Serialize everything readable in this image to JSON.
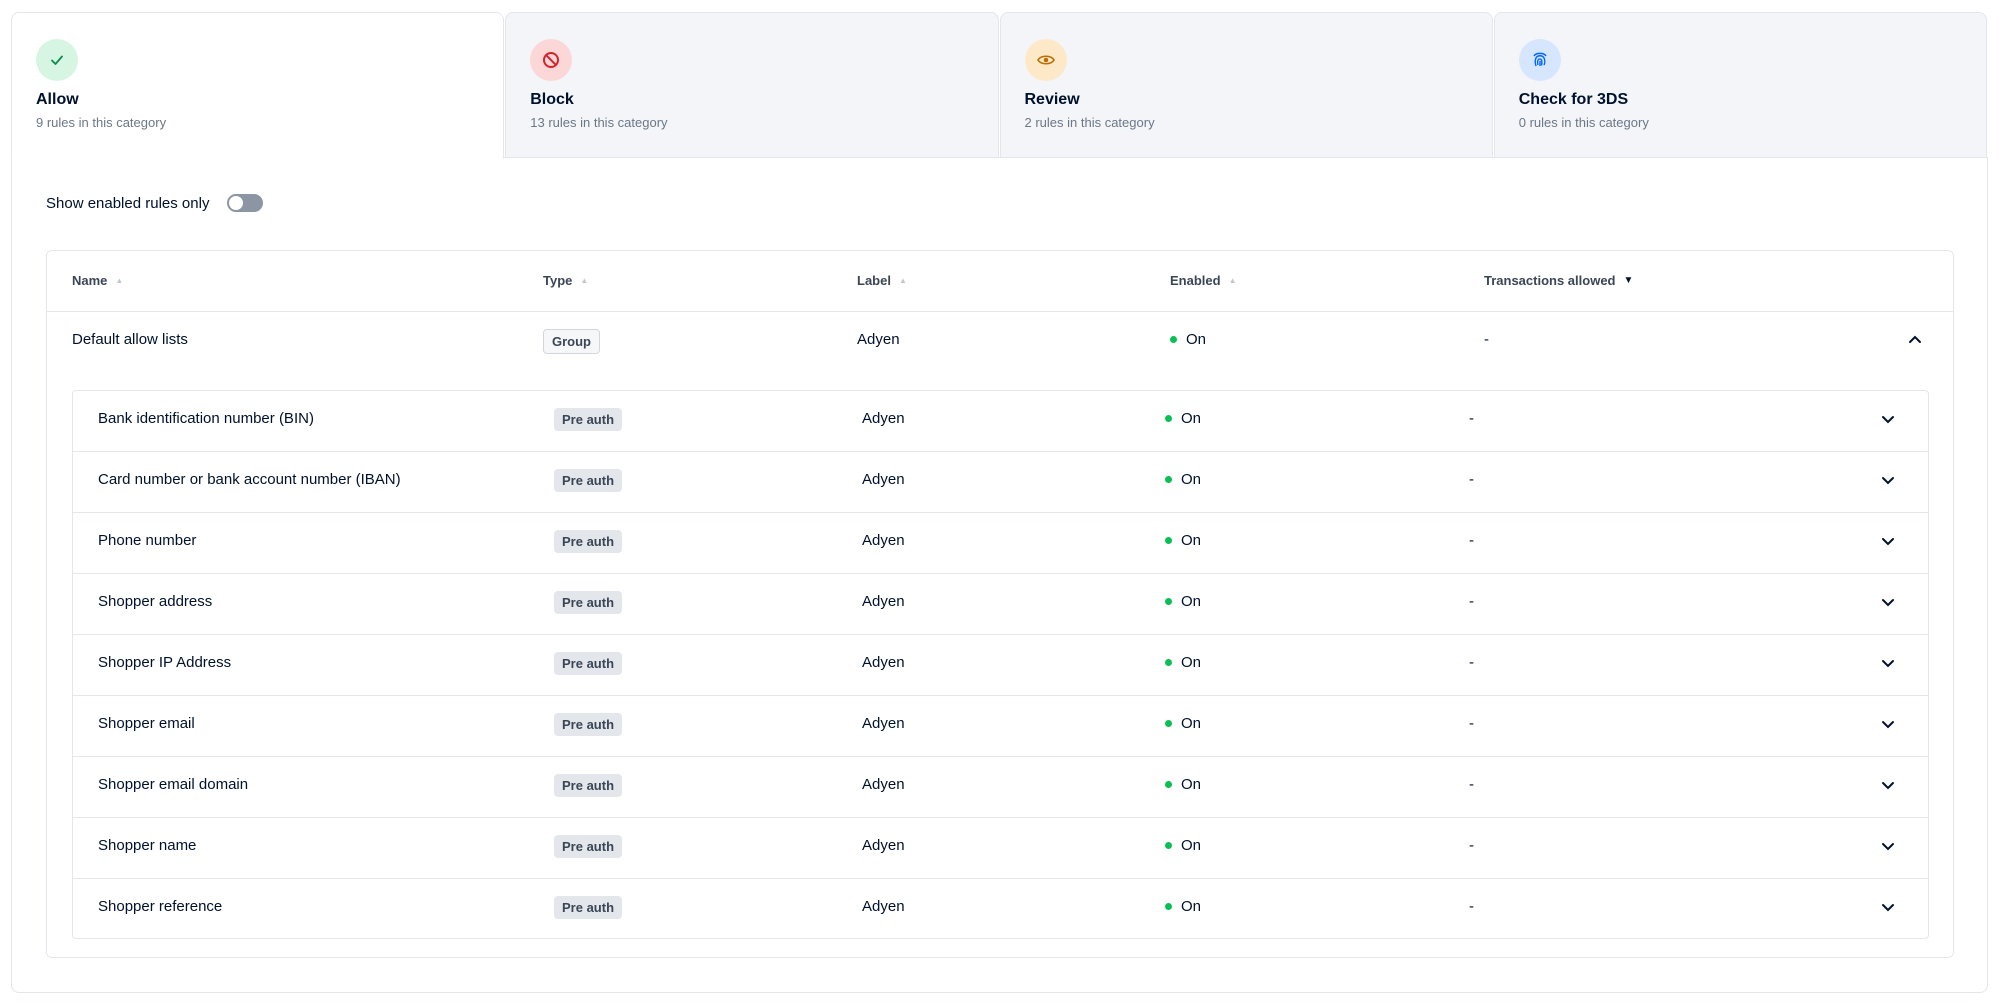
{
  "tabs": [
    {
      "key": "allow",
      "title": "Allow",
      "subtitle": "9 rules in this category",
      "icon": "check-icon",
      "icon_bg": "#d7f5e3",
      "icon_color": "#0a8f4c",
      "active": true
    },
    {
      "key": "block",
      "title": "Block",
      "subtitle": "13 rules in this category",
      "icon": "block-icon",
      "icon_bg": "#fbd7d7",
      "icon_color": "#d6232b",
      "active": false
    },
    {
      "key": "review",
      "title": "Review",
      "subtitle": "2 rules in this category",
      "icon": "eye-icon",
      "icon_bg": "#fde9c8",
      "icon_color": "#b86e00",
      "active": false
    },
    {
      "key": "check3ds",
      "title": "Check for 3DS",
      "subtitle": "0 rules in this category",
      "icon": "fingerprint-icon",
      "icon_bg": "#d6e6ff",
      "icon_color": "#0066ff",
      "active": false
    }
  ],
  "filter": {
    "label": "Show enabled rules only",
    "enabled": false
  },
  "table": {
    "columns": [
      "Name",
      "Type",
      "Label",
      "Enabled",
      "Transactions allowed"
    ],
    "sorted_column": "Transactions allowed",
    "group": {
      "name": "Default allow lists",
      "type": "Group",
      "label": "Adyen",
      "enabled": "On",
      "transactions": "-"
    },
    "rules": [
      {
        "name": "Bank identification number (BIN)",
        "type": "Pre auth",
        "label": "Adyen",
        "enabled": "On",
        "transactions": "-"
      },
      {
        "name": "Card number or bank account number (IBAN)",
        "type": "Pre auth",
        "label": "Adyen",
        "enabled": "On",
        "transactions": "-"
      },
      {
        "name": "Phone number",
        "type": "Pre auth",
        "label": "Adyen",
        "enabled": "On",
        "transactions": "-"
      },
      {
        "name": "Shopper address",
        "type": "Pre auth",
        "label": "Adyen",
        "enabled": "On",
        "transactions": "-"
      },
      {
        "name": "Shopper IP Address",
        "type": "Pre auth",
        "label": "Adyen",
        "enabled": "On",
        "transactions": "-"
      },
      {
        "name": "Shopper email",
        "type": "Pre auth",
        "label": "Adyen",
        "enabled": "On",
        "transactions": "-"
      },
      {
        "name": "Shopper email domain",
        "type": "Pre auth",
        "label": "Adyen",
        "enabled": "On",
        "transactions": "-"
      },
      {
        "name": "Shopper name",
        "type": "Pre auth",
        "label": "Adyen",
        "enabled": "On",
        "transactions": "-"
      },
      {
        "name": "Shopper reference",
        "type": "Pre auth",
        "label": "Adyen",
        "enabled": "On",
        "transactions": "-"
      }
    ]
  },
  "colors": {
    "enabled_dot": "#0abf53",
    "border": "#e3e6ea",
    "text": "#00112c"
  }
}
